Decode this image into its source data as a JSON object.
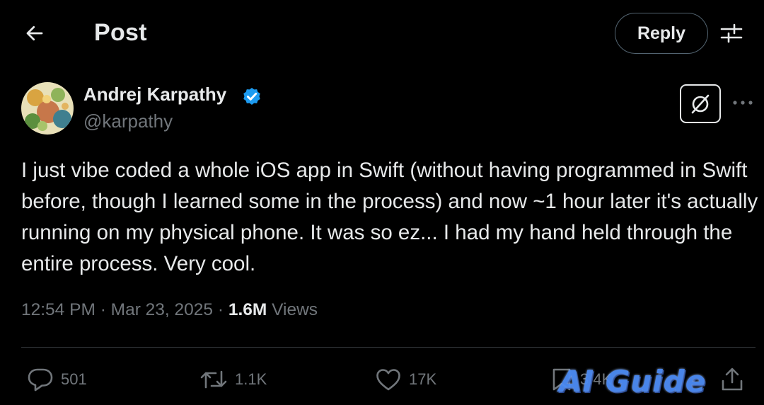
{
  "header": {
    "title": "Post",
    "reply_label": "Reply",
    "back_icon": "arrow-left-icon",
    "settings_icon": "sliders-icon"
  },
  "author": {
    "name": "Andrej Karpathy",
    "handle": "@karpathy",
    "verified": true,
    "verified_color": "#1d9bf0"
  },
  "tweet": {
    "text": "I just vibe coded a whole iOS app in Swift (without having programmed in Swift before, though I learned some in the process) and now ~1 hour later it's actually running on my physical phone. It was so ez... I had my hand held through the entire process. Very cool.",
    "time": "12:54 PM",
    "separator": "·",
    "date": "Mar 23, 2025",
    "views_count": "1.6M",
    "views_label": "Views"
  },
  "actions": {
    "replies": "501",
    "reposts": "1.1K",
    "likes": "17K",
    "bookmarks": "3.4K"
  },
  "watermark": "AI Guide",
  "colors": {
    "background": "#000000",
    "text": "#e7e9ea",
    "muted": "#71767b",
    "border": "#2f3336",
    "verified": "#1d9bf0"
  }
}
